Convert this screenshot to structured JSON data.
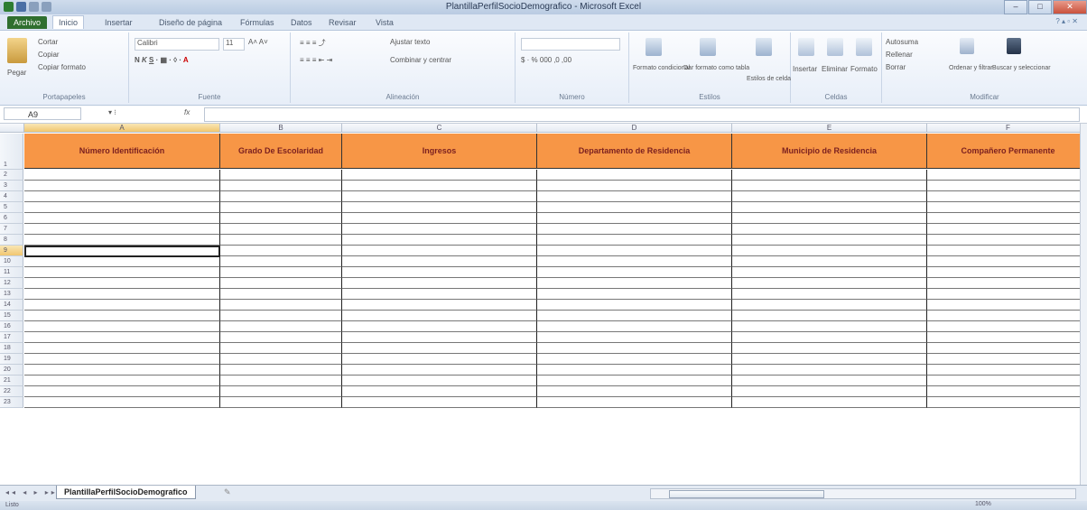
{
  "window": {
    "title": "PlantillaPerfilSocioDemografico - Microsoft Excel"
  },
  "tabs": [
    "Archivo",
    "Inicio",
    "Insertar",
    "Diseño de página",
    "Fórmulas",
    "Datos",
    "Revisar",
    "Vista"
  ],
  "ribbon": {
    "clipboard": {
      "paste": "Pegar",
      "cut": "Cortar",
      "copy": "Copiar",
      "format_painter": "Copiar formato",
      "label": "Portapapeles"
    },
    "font": {
      "name": "Calibri",
      "size": "11",
      "label": "Fuente"
    },
    "alignment": {
      "wrap": "Ajustar texto",
      "merge": "Combinar y centrar",
      "label": "Alineación"
    },
    "number": {
      "label": "Número"
    },
    "styles": {
      "conditional": "Formato condicional",
      "as_table": "Dar formato como tabla",
      "cell_styles": "Estilos de celda",
      "label": "Estilos"
    },
    "cells": {
      "insert": "Insertar",
      "delete": "Eliminar",
      "format": "Formato",
      "label": "Celdas"
    },
    "editing": {
      "autosum": "Autosuma",
      "fill": "Rellenar",
      "clear": "Borrar",
      "sort": "Ordenar y filtrar",
      "find": "Buscar y seleccionar",
      "label": "Modificar"
    }
  },
  "formula_bar": {
    "name_box": "A9",
    "fx": "fx",
    "value": ""
  },
  "columns": [
    "A",
    "B",
    "C",
    "D",
    "E",
    "F"
  ],
  "headers": [
    "Número Identificación",
    "Grado De Escolaridad",
    "Ingresos",
    "Departamento de Residencia",
    "Municipio de Residencia",
    "Compañero Permanente"
  ],
  "rows": [
    "1",
    "2",
    "3",
    "4",
    "5",
    "6",
    "7",
    "8",
    "9",
    "10",
    "11",
    "12",
    "13",
    "14",
    "15",
    "16",
    "17",
    "18",
    "19",
    "20",
    "21",
    "22",
    "23"
  ],
  "active": {
    "row": "9",
    "col": "A"
  },
  "sheet_tab": "PlantillaPerfilSocioDemografico",
  "status": {
    "ready": "Listo",
    "zoom": "100%"
  }
}
